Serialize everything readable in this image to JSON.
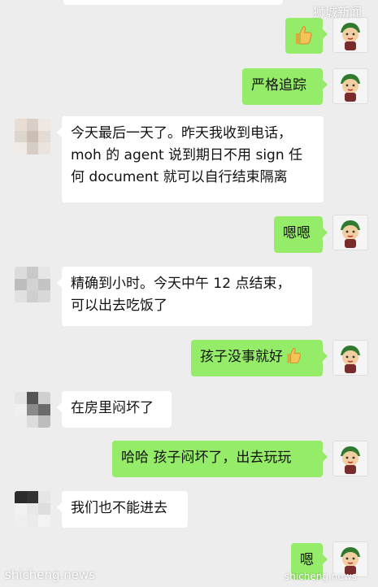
{
  "colors": {
    "background": "#ededed",
    "incoming_bubble": "#ffffff",
    "outgoing_bubble": "#95ec69"
  },
  "messages": [
    {
      "side": "out",
      "text": "",
      "emoji": "thumbs-up"
    },
    {
      "side": "out",
      "text": "严格追踪"
    },
    {
      "side": "in",
      "lines": [
        "今天最后一天了。昨天我收到电话，",
        "moh 的 agent 说到期日不用 sign 任",
        "何 document 就可以自行结束隔离"
      ]
    },
    {
      "side": "out",
      "text": "嗯嗯"
    },
    {
      "side": "in",
      "lines": [
        "精确到小时。今天中午 12 点结束，",
        "可以出去吃饭了"
      ]
    },
    {
      "side": "out",
      "text": "孩子没事就好",
      "emoji": "thumbs-up"
    },
    {
      "side": "in",
      "lines": [
        "在房里闷坏了"
      ]
    },
    {
      "side": "out",
      "text": "哈哈 孩子闷坏了，出去玩玩"
    },
    {
      "side": "in",
      "lines": [
        "我们也不能进去"
      ]
    },
    {
      "side": "out",
      "text": "嗯"
    }
  ],
  "watermarks": {
    "top_right": "狮城新闻",
    "bottom_left": "shicheng.news",
    "bottom_right": "shicheng.news"
  }
}
